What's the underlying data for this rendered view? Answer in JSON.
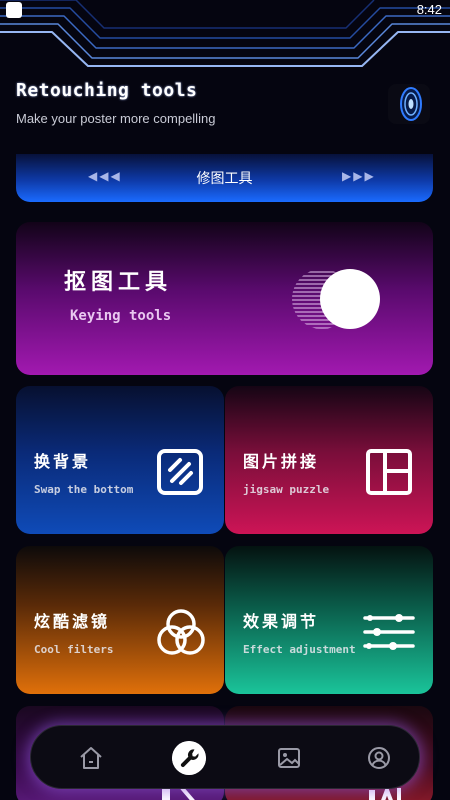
{
  "status_bar": {
    "time": "8:42"
  },
  "header": {
    "title": "Retouching tools",
    "subtitle": "Make your poster more compelling",
    "portal_icon": "portal-icon"
  },
  "banner": {
    "label": "修图工具",
    "left_arrows": "◀◀◀",
    "right_arrows": "▶▶▶"
  },
  "keying_card": {
    "title": "抠图工具",
    "subtitle": "Keying tools",
    "icon": "half-circle-cutout-icon"
  },
  "tools": [
    {
      "title": "换背景",
      "subtitle": "Swap the bottom",
      "icon": "swap-background-icon"
    },
    {
      "title": "图片拼接",
      "subtitle": "jigsaw puzzle",
      "icon": "grid-layout-icon"
    },
    {
      "title": "炫酷滤镜",
      "subtitle": "Cool filters",
      "icon": "filter-rings-icon"
    },
    {
      "title": "效果调节",
      "subtitle": "Effect adjustment",
      "icon": "sliders-icon"
    }
  ],
  "bottom_nav": {
    "items": [
      {
        "name": "home",
        "icon": "home-icon",
        "active": false
      },
      {
        "name": "tools",
        "icon": "wrench-icon",
        "active": true
      },
      {
        "name": "gallery",
        "icon": "image-icon",
        "active": false
      },
      {
        "name": "profile",
        "icon": "user-icon",
        "active": false
      }
    ]
  },
  "colors": {
    "banner_accent": "#1a6bff",
    "keying_accent": "#a219b0",
    "swap_accent": "#0f4bb8",
    "jigsaw_accent": "#cd1456",
    "filters_accent": "#e0700a",
    "effect_accent": "#1ac49a",
    "nav_glow": "#9a5ae6"
  }
}
